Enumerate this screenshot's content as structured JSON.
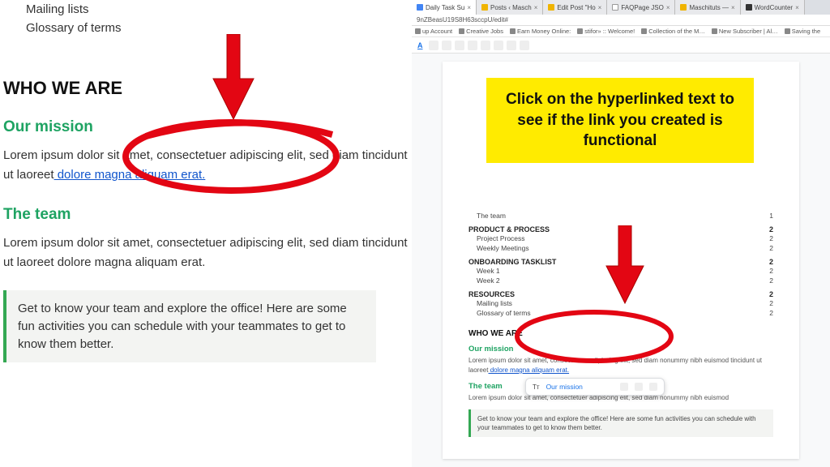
{
  "left": {
    "nav_items": [
      "Mailing lists",
      "Glossary of terms"
    ],
    "heading": "WHO WE ARE",
    "mission_title": "Our mission",
    "mission_body_pre": "Lorem ipsum dolor sit amet, consectetuer adipiscing elit, sed diam tincidunt ut laoreet",
    "mission_link": " dolore magna aliquam erat.",
    "team_title": "The team",
    "team_body": "Lorem ipsum dolor sit amet, consectetuer adipiscing elit, sed diam tincidunt ut laoreet dolore magna aliquam erat.",
    "callout": "Get to know your team and explore the office! Here are some fun activities you can schedule with your teammates to get to know them better."
  },
  "annotation": "Click on the hyperlinked text to see if the link you created is functional",
  "tabs": [
    {
      "label": "Daily Task Su",
      "ico": "g"
    },
    {
      "label": "Posts ‹ Masch",
      "ico": "y"
    },
    {
      "label": "Edit Post \"Ho",
      "ico": "y"
    },
    {
      "label": "FAQPage JSO",
      "ico": "w"
    },
    {
      "label": "Maschituts —",
      "ico": "y"
    },
    {
      "label": "WordCounter",
      "ico": "b"
    }
  ],
  "url_fragment": "9nZBeasU19S8H63sccpU/edit#",
  "bookmarks": [
    "up Account",
    "Creative Jobs",
    "Earn Money Online:",
    "stifor» :: Welcome!",
    "Collection of the M…",
    "New Subscriber | Al…",
    "Saving the"
  ],
  "doc": {
    "sec1": {
      "theteam": "The team",
      "pn": "1"
    },
    "sec2": {
      "title": "PRODUCT & PROCESS",
      "items": [
        "Project Process",
        "Weekly Meetings"
      ],
      "pn": "2"
    },
    "sec3": {
      "title": "ONBOARDING TASKLIST",
      "items": [
        "Week 1",
        "Week 2"
      ],
      "pn": "2"
    },
    "sec4": {
      "title": "RESOURCES",
      "items": [
        "Mailing lists",
        "Glossary of terms"
      ],
      "pn": "2"
    },
    "heading": "WHO WE ARE",
    "mission_title": "Our mission",
    "mission_body": "Lorem ipsum dolor sit amet, consectetuer adipiscing elit, sed diam nonummy nibh euismod tincidunt ut laoreet",
    "mission_link": " dolore magna aliquam erat.",
    "team_title": "The team",
    "team_body": "Lorem ipsum dolor sit amet, consectetuer adipiscing elit, sed diam nonummy nibh euismod",
    "callout": "Get to know your team and explore the office! Here are some fun activities you can schedule with your teammates to get to know them better."
  },
  "popover": {
    "label": "Our mission"
  }
}
